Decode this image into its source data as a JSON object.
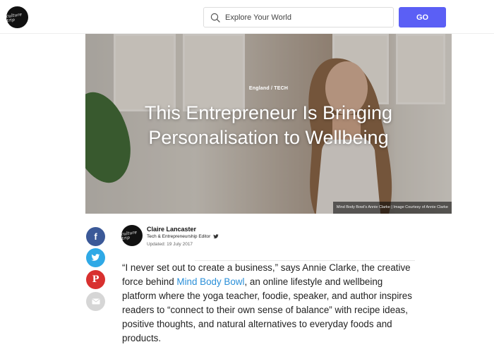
{
  "header": {
    "logo_text": "culture trip",
    "search_placeholder": "Explore Your World",
    "search_value": "",
    "go_label": "GO"
  },
  "hero": {
    "category": "England / TECH",
    "title_line1": "This Entrepreneur Is Bringing",
    "title_line2": "Personalisation to Wellbeing",
    "caption": "Mind Body Bowl's Annie Clarke | Image Courtesy of Annie Clarke"
  },
  "share": {
    "facebook_icon": "facebook-icon",
    "twitter_icon": "twitter-icon",
    "pinterest_icon": "pinterest-icon",
    "email_icon": "email-icon"
  },
  "author": {
    "name": "Claire Lancaster",
    "role": "Tech & Entrepreneurship Editor",
    "updated": "Updated: 19 July 2017"
  },
  "article": {
    "text_before": "“I never set out to create a business,” says Annie Clarke, the creative force behind ",
    "link_text": "Mind Body Bowl",
    "text_after": ", an online lifestyle and wellbeing platform where the yoga teacher, foodie, speaker, and author inspires readers to “connect to their own sense of balance” with recipe ideas, positive thoughts, and natural alternatives to everyday foods and products."
  },
  "colors": {
    "go_button": "#5b5ff5",
    "facebook": "#3b5998",
    "twitter": "#2fa9e6",
    "pinterest": "#d8302f",
    "email": "#d6d6d6",
    "link": "#2a8fd8"
  }
}
